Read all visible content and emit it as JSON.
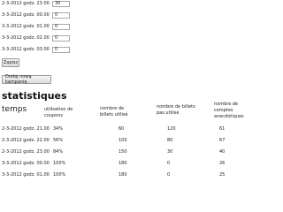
{
  "form": {
    "rows": [
      {
        "label": "2-3-2012 godz. 23.00",
        "value": "30"
      },
      {
        "label": "3-3-2012 godz. 00.00",
        "value": "0"
      },
      {
        "label": "3-3-2012 godz. 01.00",
        "value": "0"
      },
      {
        "label": "3-3-2012 godz. 02.00",
        "value": "0"
      },
      {
        "label": "3-3-2012 godz. 03.00",
        "value": "0"
      }
    ],
    "save_label": "Zapisz",
    "add_campaign_label": "Dodaj nową kampanię"
  },
  "stats": {
    "title": "statistiques",
    "headers": {
      "time": "temps",
      "usage": "utilisation de coupons",
      "used": "nombre de billets utilisé",
      "unused": "nombre de billets pas utilisé",
      "anecdotal": "nombre de comptes anecdotiques"
    },
    "rows": [
      {
        "time": "2-3-2012 godz. 21.00",
        "usage": "34%",
        "used": "60",
        "unused": "120",
        "anecdotal": "61"
      },
      {
        "time": "2-3-2012 godz. 22.00",
        "usage": "56%",
        "used": "100",
        "unused": "80",
        "anecdotal": "67"
      },
      {
        "time": "2-3-2012 godz. 23.00",
        "usage": "84%",
        "used": "150",
        "unused": "30",
        "anecdotal": "40"
      },
      {
        "time": "3-3-2012 godz. 00.00",
        "usage": "100%",
        "used": "180",
        "unused": "0",
        "anecdotal": "26"
      },
      {
        "time": "3-3-2012 godz. 01.00",
        "usage": "100%",
        "used": "180",
        "unused": "0",
        "anecdotal": "25"
      }
    ]
  }
}
